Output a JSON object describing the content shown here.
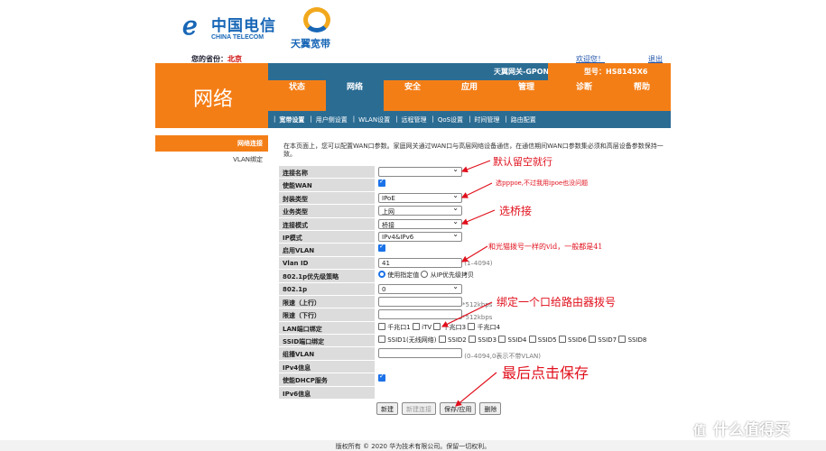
{
  "header": {
    "logo_brand_cn": "中国电信",
    "logo_brand_en": "CHINA TELECOM",
    "logo_product": "天翼宽带",
    "province_label": "您的省份：",
    "province_value": "北京",
    "welcome": "欢迎您！",
    "logout": "退出",
    "gateway": "天翼网关-GPON",
    "model": "型号：HS8145X6"
  },
  "section_title": "网络",
  "nav": [
    "状态",
    "网络",
    "安全",
    "应用",
    "管理",
    "诊断",
    "帮助"
  ],
  "subnav": [
    "宽带设置",
    "用户侧设置",
    "WLAN设置",
    "远程管理",
    "QoS设置",
    "时间管理",
    "路由配置"
  ],
  "sidebar": [
    "网络连接",
    "VLAN绑定"
  ],
  "description": "在本页面上，您可以配置WAN口参数。家庭网关通过WAN口与高层网络设备通信，在通信期间WAN口参数集必须和高层设备参数保持一致。",
  "form": {
    "labels": [
      "连接名称",
      "使能WAN",
      "封装类型",
      "业务类型",
      "连接模式",
      "IP模式",
      "启用VLAN",
      "Vlan ID",
      "802.1p优先级策略",
      "802.1p",
      "限速（上行）",
      "限速（下行）",
      "LAN端口绑定",
      "SSID端口绑定",
      "组播VLAN",
      "IPv4信息",
      "使能DHCP服务",
      "IPv6信息"
    ],
    "encap": "IPoE",
    "service": "上网",
    "mode": "桥接",
    "ip_mode": "IPv4&IPv6",
    "vlan_id": "41",
    "vlan_hint": "(1–4094)",
    "prio_opt1": "使用指定值",
    "prio_opt2": "从IP优先级拷贝",
    "p8021": "0",
    "up_hint": "*512kbps",
    "down_hint": "*512kbps",
    "lan_ports": [
      "千兆口1",
      "iTV",
      "千兆口3",
      "千兆口4"
    ],
    "ssids": [
      "SSID1(无线网络)",
      "SSID2",
      "SSID3",
      "SSID4",
      "SSID5",
      "SSID6",
      "SSID7",
      "SSID8"
    ],
    "mcast_hint": "(0–4094,0表示不带VLAN)"
  },
  "buttons": [
    "新建",
    "新建连接",
    "保存/应用",
    "删除"
  ],
  "annotations": [
    "默认留空就行",
    "选pppoe,不过我用ipoe也没问题",
    "选桥接",
    "和光猫拨号一样的vid，一般都是41",
    "绑定一个口给路由器拨号",
    "最后点击保存"
  ],
  "footer": "版权所有 © 2020 华为技术有限公司。保留一切权利。",
  "watermark": "什么值得买",
  "colors": {
    "orange": "#f47e16",
    "blue": "#2b6c93",
    "annotation": "#e0101c"
  }
}
